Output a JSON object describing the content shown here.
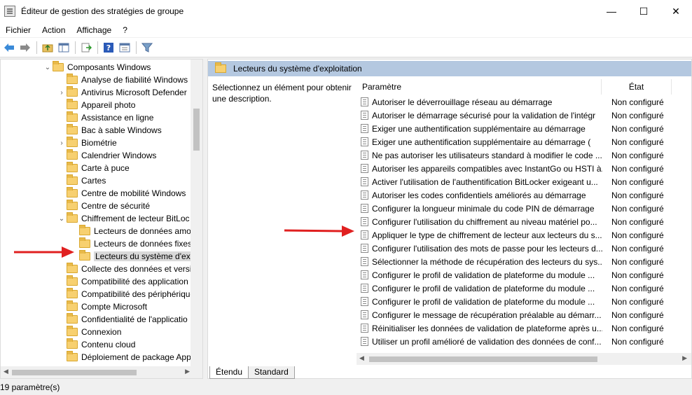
{
  "window": {
    "title": "Éditeur de gestion des stratégies de groupe",
    "controls": {
      "minimize": "—",
      "maximize": "☐",
      "close": "✕"
    }
  },
  "menu": [
    "Fichier",
    "Action",
    "Affichage",
    "?"
  ],
  "toolbar": {
    "buttons": [
      "back-icon",
      "forward-icon",
      "up-folder-icon",
      "show-hide-tree-icon",
      "export-list-icon",
      "help-icon",
      "properties-icon",
      "filter-icon"
    ]
  },
  "tree": {
    "items": [
      {
        "label": "Composants Windows",
        "expander": "⌄",
        "indent": 1
      },
      {
        "label": "Analyse de fiabilité Windows",
        "expander": "",
        "indent": 2
      },
      {
        "label": "Antivirus Microsoft Defender",
        "expander": "›",
        "indent": 2
      },
      {
        "label": "Appareil photo",
        "expander": "",
        "indent": 2
      },
      {
        "label": "Assistance en ligne",
        "expander": "",
        "indent": 2
      },
      {
        "label": "Bac à sable Windows",
        "expander": "",
        "indent": 2
      },
      {
        "label": "Biométrie",
        "expander": "›",
        "indent": 2
      },
      {
        "label": "Calendrier Windows",
        "expander": "",
        "indent": 2
      },
      {
        "label": "Carte à puce",
        "expander": "",
        "indent": 2
      },
      {
        "label": "Cartes",
        "expander": "",
        "indent": 2
      },
      {
        "label": "Centre de mobilité Windows",
        "expander": "",
        "indent": 2
      },
      {
        "label": "Centre de sécurité",
        "expander": "",
        "indent": 2
      },
      {
        "label": "Chiffrement de lecteur BitLoc",
        "expander": "⌄",
        "indent": 2
      },
      {
        "label": "Lecteurs de données amo",
        "expander": "",
        "indent": 3
      },
      {
        "label": "Lecteurs de données fixes",
        "expander": "",
        "indent": 3
      },
      {
        "label": "Lecteurs du système d'exp",
        "expander": "",
        "indent": 3,
        "selected": true
      },
      {
        "label": "Collecte des données et versio",
        "expander": "",
        "indent": 2
      },
      {
        "label": "Compatibilité des application",
        "expander": "",
        "indent": 2
      },
      {
        "label": "Compatibilité des périphérique",
        "expander": "",
        "indent": 2
      },
      {
        "label": "Compte Microsoft",
        "expander": "",
        "indent": 2
      },
      {
        "label": "Confidentialité de l'applicatio",
        "expander": "",
        "indent": 2
      },
      {
        "label": "Connexion",
        "expander": "",
        "indent": 2
      },
      {
        "label": "Contenu cloud",
        "expander": "",
        "indent": 2
      },
      {
        "label": "Déploiement de package App",
        "expander": "",
        "indent": 2
      }
    ]
  },
  "right": {
    "header": "Lecteurs du système d'exploitation",
    "description": "Sélectionnez un élément pour obtenir une description.",
    "columns": {
      "param": "Paramètre",
      "state": "État"
    },
    "rows": [
      {
        "name": "Autoriser le déverrouillage réseau au démarrage",
        "state": "Non configuré"
      },
      {
        "name": "Autoriser le démarrage sécurisé pour la validation de l'intégr",
        "state": "Non configuré"
      },
      {
        "name": "Exiger une authentification supplémentaire au démarrage",
        "state": "Non configuré"
      },
      {
        "name": "Exiger une authentification supplémentaire au démarrage (",
        "state": "Non configuré"
      },
      {
        "name": "Ne pas autoriser les utilisateurs standard à modifier le code ...",
        "state": "Non configuré"
      },
      {
        "name": "Autoriser les appareils compatibles avec InstantGo ou HSTI à...",
        "state": "Non configuré"
      },
      {
        "name": "Activer l'utilisation de l'authentification BitLocker exigeant u...",
        "state": "Non configuré"
      },
      {
        "name": "Autoriser les codes confidentiels améliorés au démarrage",
        "state": "Non configuré"
      },
      {
        "name": "Configurer la longueur minimale du code PIN de démarrage",
        "state": "Non configuré"
      },
      {
        "name": "Configurer l'utilisation du chiffrement au niveau matériel po...",
        "state": "Non configuré"
      },
      {
        "name": "Appliquer le type de chiffrement de lecteur aux lecteurs du s...",
        "state": "Non configuré"
      },
      {
        "name": "Configurer l'utilisation des mots de passe pour les lecteurs d...",
        "state": "Non configuré"
      },
      {
        "name": "Sélectionner la méthode de récupération des lecteurs du sys...",
        "state": "Non configuré"
      },
      {
        "name": "Configurer le profil de validation de plateforme du module ...",
        "state": "Non configuré"
      },
      {
        "name": "Configurer le profil de validation de plateforme du module ...",
        "state": "Non configuré"
      },
      {
        "name": "Configurer le profil de validation de plateforme du module ...",
        "state": "Non configuré"
      },
      {
        "name": "Configurer le message de récupération préalable au démarr...",
        "state": "Non configuré"
      },
      {
        "name": "Réinitialiser les données de validation de plateforme après u...",
        "state": "Non configuré"
      },
      {
        "name": "Utiliser un profil amélioré de validation des données de conf...",
        "state": "Non configuré"
      }
    ],
    "tabs": [
      "Étendu",
      "Standard"
    ]
  },
  "status": "19 paramètre(s)",
  "colors": {
    "header_bg": "#b4c8e0",
    "annotation_arrow": "#e02020",
    "folder": "#f7d070"
  }
}
